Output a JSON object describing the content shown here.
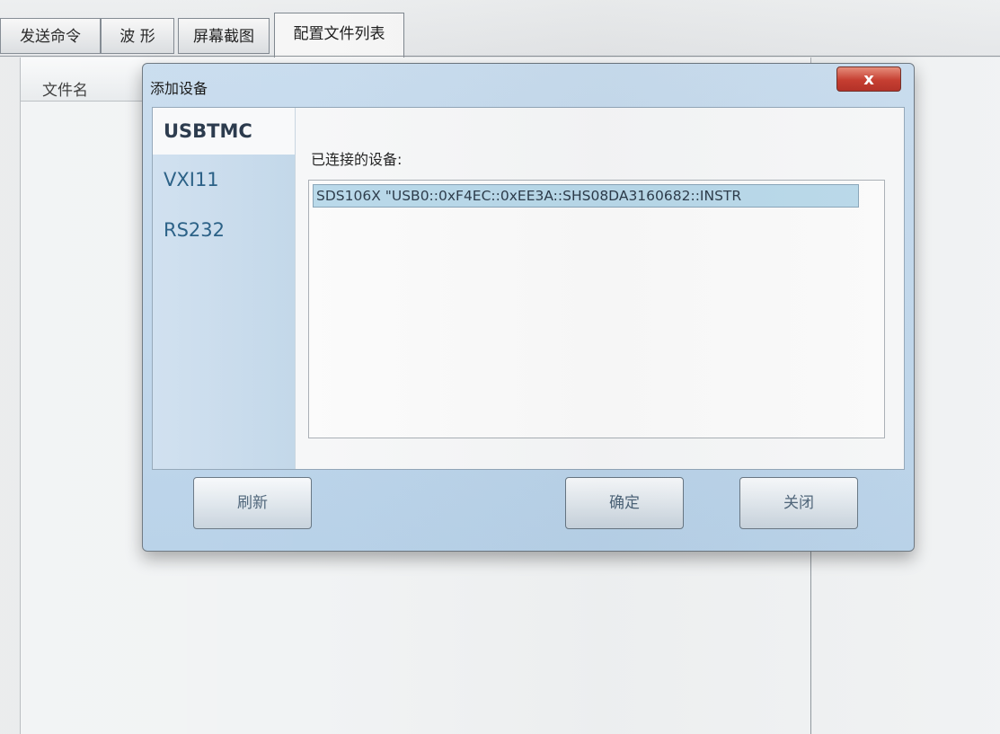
{
  "main_tabs": [
    {
      "label": "发送命令"
    },
    {
      "label": "波 形"
    },
    {
      "label": "屏幕截图"
    },
    {
      "label": "配置文件列表"
    }
  ],
  "file_panel": {
    "header_label": "文件名"
  },
  "dialog": {
    "title": "添加设备",
    "close_label": "x",
    "nav_items": [
      {
        "label": "USBTMC"
      },
      {
        "label": "VXI11"
      },
      {
        "label": "RS232"
      }
    ],
    "connected_label": "已连接的设备:",
    "devices": [
      {
        "text": "SDS106X  \"USB0::0xF4EC::0xEE3A::SHS08DA3160682::INSTR"
      }
    ],
    "buttons": {
      "refresh": "刷新",
      "ok": "确定",
      "close": "关闭"
    }
  }
}
